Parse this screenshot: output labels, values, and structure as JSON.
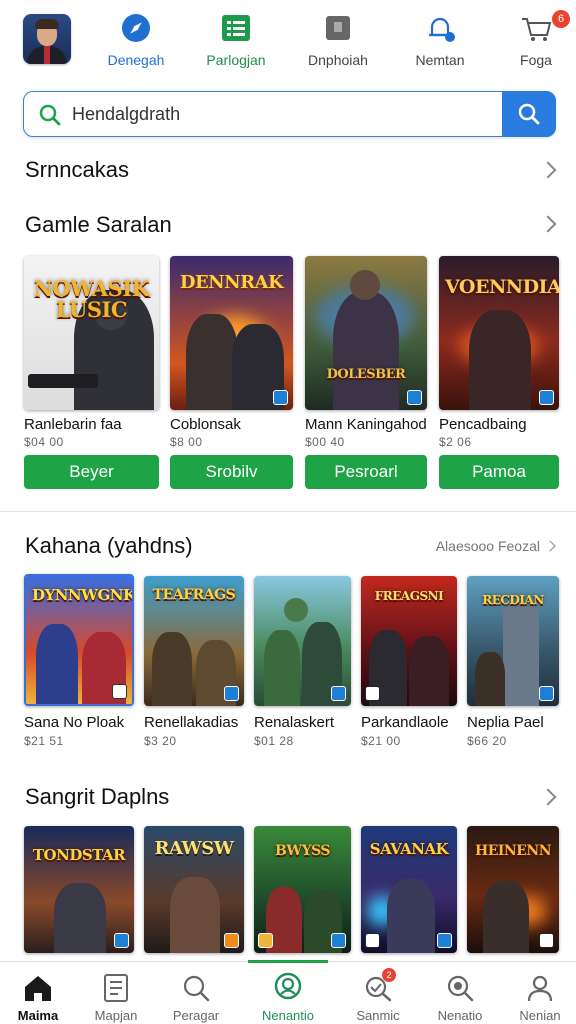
{
  "colors": {
    "accent_blue": "#2a7bde",
    "buy_green": "#1fa347",
    "badge_red": "#e8432f"
  },
  "topnav": {
    "items": [
      {
        "label": "Denegah",
        "icon": "compass-icon"
      },
      {
        "label": "Parlogjan",
        "icon": "list-icon"
      },
      {
        "label": "Dnphoiah",
        "icon": "square-icon"
      },
      {
        "label": "Nemtan",
        "icon": "bell-icon"
      },
      {
        "label": "Foga",
        "icon": "cart-icon",
        "badge": "6"
      }
    ]
  },
  "search": {
    "value": "Hendalgdrath"
  },
  "sections": {
    "s1": {
      "title": "Srnncakas"
    },
    "s2": {
      "title": "Gamle Saralan",
      "games": [
        {
          "name": "Ranlebarin faa",
          "price": "$04 00",
          "button": "Beyer",
          "logo": "NOWASIK LUSIC"
        },
        {
          "name": "Coblonsak",
          "price": "$8 00",
          "button": "Srobilv",
          "logo": "DENNRAK"
        },
        {
          "name": "Mann Kaningahod",
          "price": "$00 40",
          "button": "Pesroarl",
          "logo": "DOLESBER"
        },
        {
          "name": "Pencadbaing",
          "price": "$2 06",
          "button": "Pamoa",
          "logo": "VOENNDIA"
        }
      ]
    },
    "s3": {
      "title": "Kahana (yahdns)",
      "see_all": "Alaesooo Feozal",
      "games": [
        {
          "name": "Sana No Ploak",
          "price": "$21 51",
          "logo": "DYNNWGNK"
        },
        {
          "name": "Renellakadias",
          "price": "$3 20",
          "logo": "TEAFRAGS"
        },
        {
          "name": "Renalaskert",
          "price": "$01 28",
          "logo": ""
        },
        {
          "name": "Parkandlaole",
          "price": "$21 00",
          "logo": "FREAGSNI"
        },
        {
          "name": "Neplia Pael",
          "price": "$66 20",
          "logo": "RECDIAN"
        }
      ]
    },
    "s4": {
      "title": "Sangrit Daplns",
      "games": [
        {
          "logo": "TONDSTAR"
        },
        {
          "logo": "RAWSW"
        },
        {
          "logo": "BWYSS"
        },
        {
          "logo": "SAVANAK"
        },
        {
          "logo": "HEINENN"
        }
      ]
    }
  },
  "tabbar": {
    "items": [
      {
        "label": "Maima",
        "icon": "home-icon"
      },
      {
        "label": "Mapjan",
        "icon": "document-icon"
      },
      {
        "label": "Peragar",
        "icon": "search-icon"
      },
      {
        "label": "Nenantio",
        "icon": "location-icon"
      },
      {
        "label": "Sanmic",
        "icon": "search-check-icon",
        "badge": "2"
      },
      {
        "label": "Nenatio",
        "icon": "magnifier-icon"
      },
      {
        "label": "Nenian",
        "icon": "person-icon"
      }
    ]
  }
}
